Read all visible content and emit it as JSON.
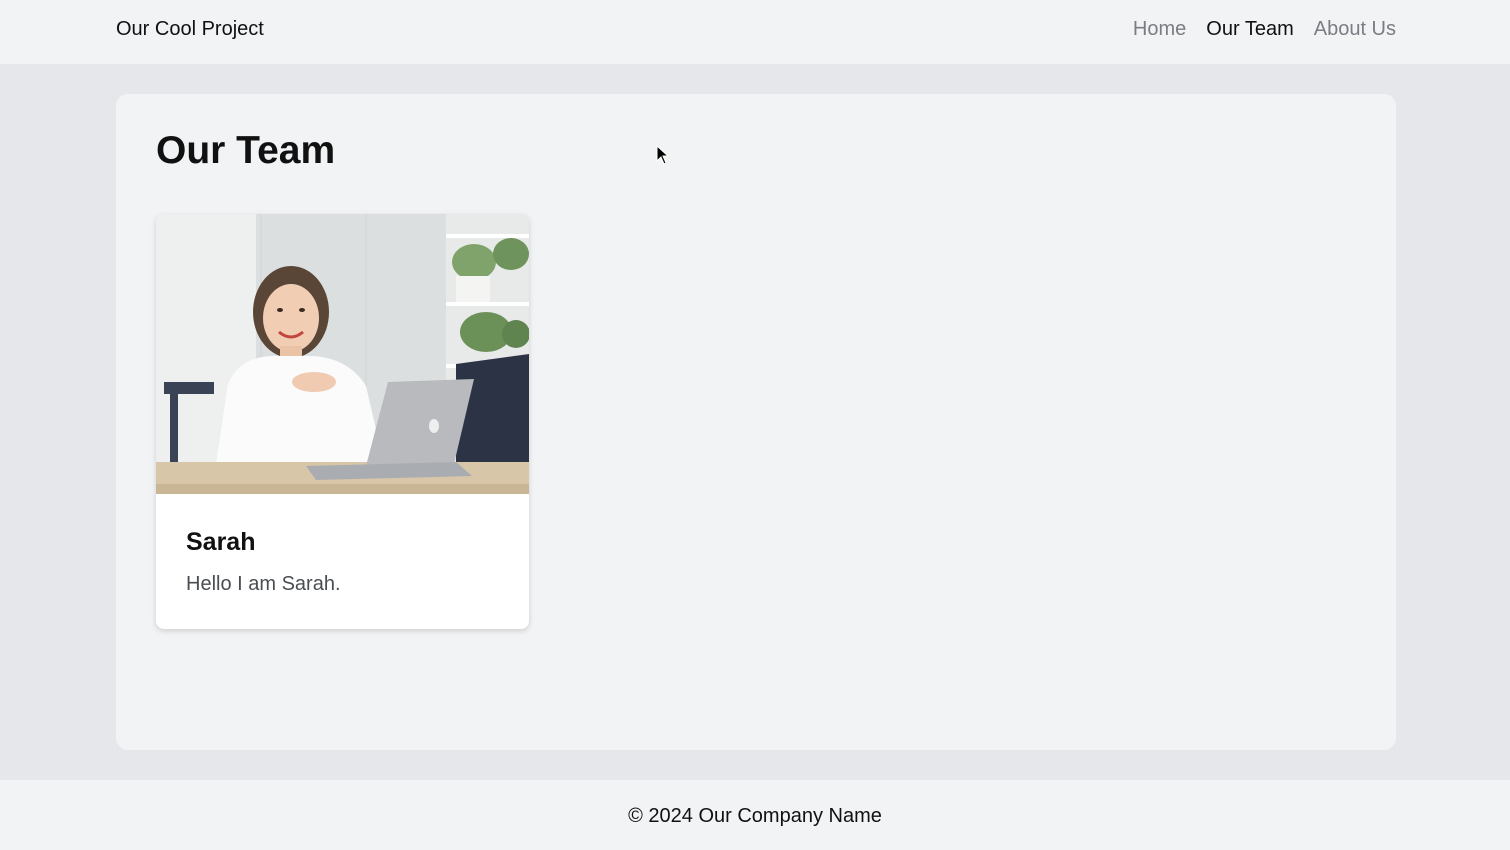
{
  "header": {
    "brand": "Our Cool Project",
    "nav": [
      {
        "label": "Home",
        "active": false
      },
      {
        "label": "Our Team",
        "active": true
      },
      {
        "label": "About Us",
        "active": false
      }
    ]
  },
  "main": {
    "title": "Our Team",
    "members": [
      {
        "name": "Sarah",
        "bio": "Hello I am Sarah."
      }
    ]
  },
  "footer": {
    "text": "© 2024 Our Company Name"
  },
  "colors": {
    "page_bg": "#e6e7ea",
    "surface": "#f1f3f5",
    "text": "#111111",
    "nav_inactive": "#7a7d82",
    "muted_text": "#4a4d52"
  },
  "icons": {
    "cursor": "mouse-pointer-icon"
  }
}
